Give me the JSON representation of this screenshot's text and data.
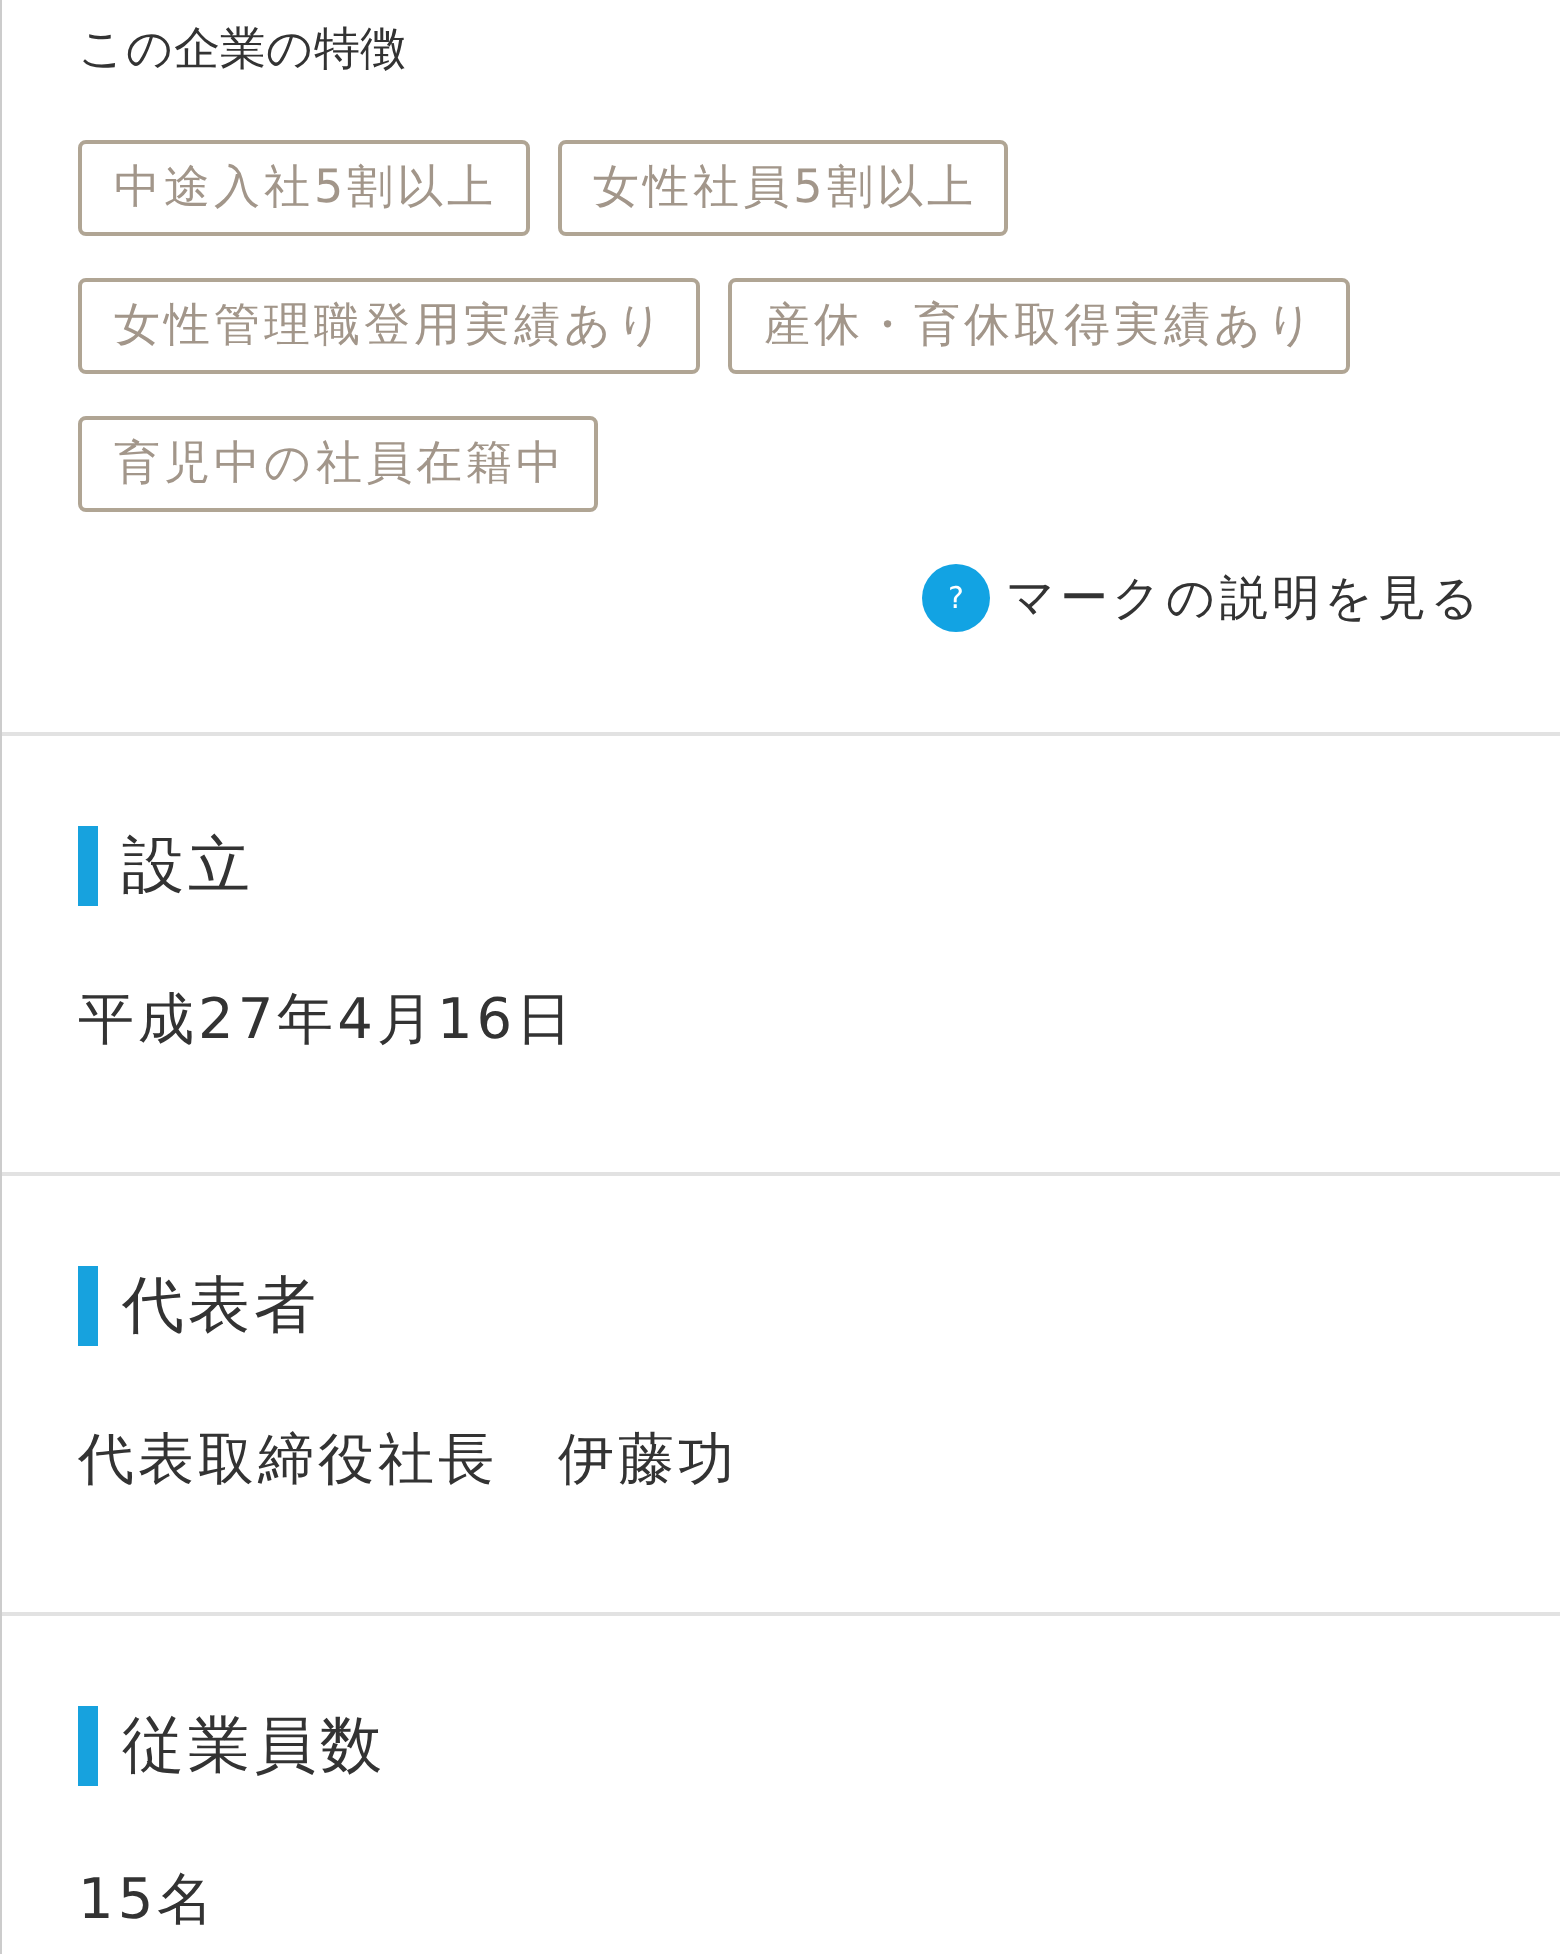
{
  "features": {
    "title": "この企業の特徴",
    "tags": [
      "中途入社5割以上",
      "女性社員5割以上",
      "女性管理職登用実績あり",
      "産休・育休取得実績あり",
      "育児中の社員在籍中"
    ],
    "help_link": {
      "icon": "?",
      "label": "マークの説明を見る"
    }
  },
  "sections": [
    {
      "heading": "設立",
      "value": "平成27年4月16日"
    },
    {
      "heading": "代表者",
      "value": "代表取締役社長　伊藤功"
    },
    {
      "heading": "従業員数",
      "value": "15名"
    }
  ]
}
